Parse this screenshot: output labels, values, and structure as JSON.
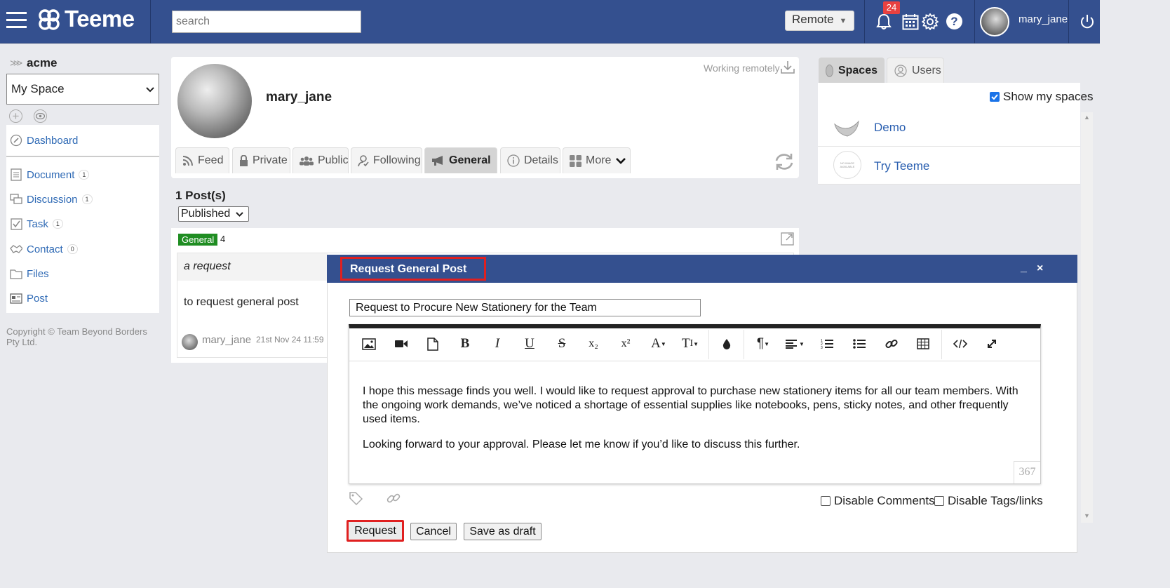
{
  "header": {
    "app_name": "Teeme",
    "search_placeholder": "search",
    "location_mode": "Remote",
    "notification_count": "24",
    "username": "mary_jane"
  },
  "sidebar": {
    "org": "acme",
    "space": "My Space",
    "items": [
      {
        "label": "Dashboard",
        "count": ""
      },
      {
        "label": "Document",
        "count": "1"
      },
      {
        "label": "Discussion",
        "count": "1"
      },
      {
        "label": "Task",
        "count": "1"
      },
      {
        "label": "Contact",
        "count": "0"
      },
      {
        "label": "Files",
        "count": ""
      },
      {
        "label": "Post",
        "count": ""
      }
    ],
    "copyright": "Copyright © Team Beyond Borders Pty Ltd."
  },
  "profile": {
    "name": "mary_jane",
    "status": "Working remotely",
    "tabs": [
      "Feed",
      "Private",
      "Public",
      "Following",
      "General",
      "Details",
      "More"
    ],
    "active_tab": "General"
  },
  "posts": {
    "count_label": "1 Post(s)",
    "filter": "Published",
    "category": "General",
    "category_count": "4",
    "title": "a request",
    "body": "to request general post",
    "author": "mary_jane",
    "date": "21st Nov 24 11:59"
  },
  "right_panel": {
    "tabs": [
      "Spaces",
      "Users"
    ],
    "show_my_spaces": "Show my spaces",
    "spaces": [
      "Demo",
      "Try Teeme"
    ],
    "no_image_text": "NO IMAGE AVAILABLE"
  },
  "modal": {
    "title": "Request General Post",
    "minimize": "_",
    "close": "×",
    "subject": "Request to Procure New Stationery for the Team",
    "paragraph1": "I hope this message finds you well. I would like to request approval to purchase new stationery items for all our team members. With the ongoing work demands, we’ve noticed a shortage of essential supplies like notebooks, pens, sticky notes, and other frequently used items.",
    "paragraph2": "Looking forward to your approval. Please let me know if you’d like to discuss this further.",
    "char_count": "367",
    "disable_comments": "Disable Comments",
    "disable_tags": "Disable Tags/links",
    "buttons": {
      "request": "Request",
      "cancel": "Cancel",
      "draft": "Save as draft"
    },
    "toolbar": {
      "bold": "B",
      "italic": "I",
      "underline": "U",
      "strike": "S",
      "subscript": "x₂",
      "superscript": "x²",
      "font_color": "A",
      "font_size": "T",
      "paragraph": "¶"
    }
  },
  "colors": {
    "brand": "#34508f",
    "highlight": "#e02020",
    "badge_green": "#1f8d22",
    "link": "#2f6ab5"
  }
}
